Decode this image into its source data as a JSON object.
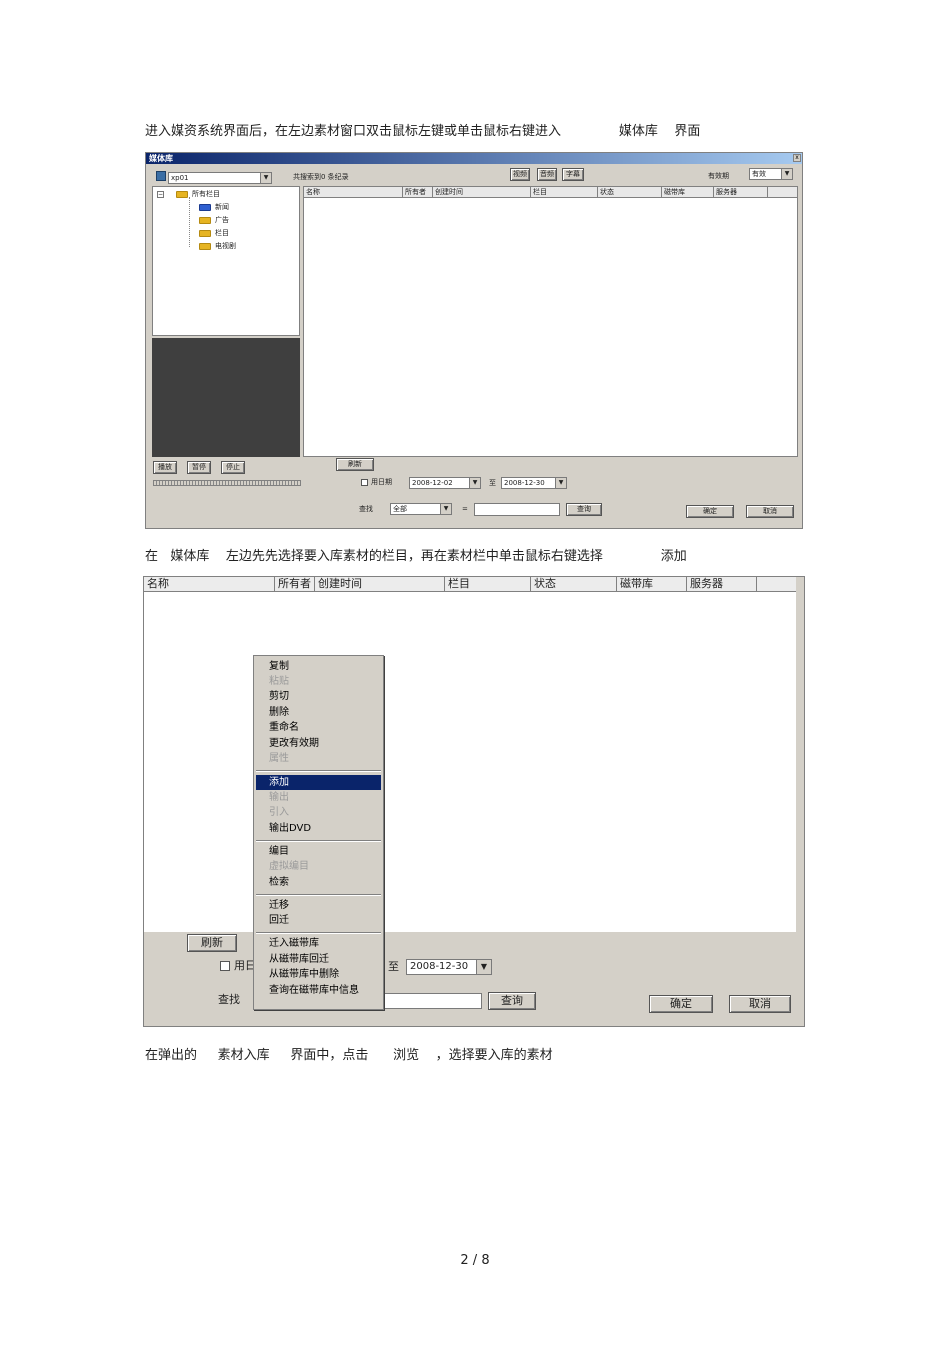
{
  "paragraphs": {
    "p1": "进入媒资系统界面后，在左边素材窗口双击鼠标左键或单击鼠标右键进入              媒体库    界面",
    "p2": "在   媒体库    左边先先选择要入库素材的栏目，再在素材栏中单击鼠标右键选择              添加",
    "p3": "在弹出的     素材入库     界面中，点击      浏览    ，选择要入库的素材"
  },
  "shot1": {
    "title": "媒体库",
    "close": "x",
    "server_select": "xp01",
    "search_count": "共搜索到0 条纪录",
    "tabs": [
      "视频",
      "音频",
      "字幕"
    ],
    "validity_label": "有效期",
    "validity_value": "有效",
    "tree": {
      "root": "所有栏目",
      "children": [
        "新闻",
        "广告",
        "栏目",
        "电视剧"
      ]
    },
    "columns": [
      "名称",
      "所有者",
      "创建时间",
      "栏目",
      "状态",
      "磁带库",
      "服务器"
    ],
    "player_buttons": [
      "播放",
      "暂停",
      "停止"
    ],
    "refresh": "刷新",
    "use_date": "用日期",
    "date_from": "2008-12-02",
    "to_label": "至",
    "date_to": "2008-12-30",
    "find_label": "查找",
    "find_scope": "全部",
    "equals": "=",
    "query": "查询",
    "ok": "确定",
    "cancel": "取消"
  },
  "shot2": {
    "columns": [
      "名称",
      "所有者",
      "创建时间",
      "栏目",
      "状态",
      "磁带库",
      "服务器"
    ],
    "refresh": "刷新",
    "use_date_partial": "用日",
    "to_label": "至",
    "date_to": "2008-12-30",
    "find_label": "查找",
    "query": "查询",
    "ok": "确定",
    "cancel": "取消",
    "menu": {
      "group1": [
        "复制",
        "粘贴",
        "剪切",
        "删除",
        "重命名",
        "更改有效期",
        "属性"
      ],
      "group2": [
        "添加",
        "输出",
        "引入",
        "输出DVD"
      ],
      "group3": [
        "编目",
        "虚拟编目",
        "检索"
      ],
      "group4": [
        "迁移",
        "回迁"
      ],
      "group5": [
        "迁入磁带库",
        "从磁带库回迁",
        "从磁带库中删除",
        "查询在磁带库中信息"
      ]
    }
  },
  "page_number": "2 / 8"
}
